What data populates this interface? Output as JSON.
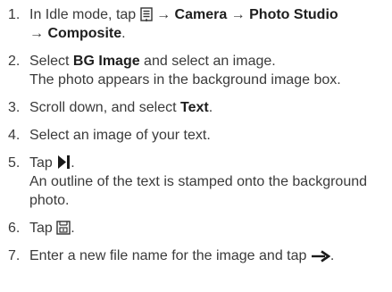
{
  "steps": [
    {
      "num": "1.",
      "t1": "In Idle mode, tap ",
      "icon": "menu-list-icon",
      "arrow1": " → ",
      "camera": "Camera",
      "arrow2": " → ",
      "studio": "Photo Studio",
      "arrow3": "→ ",
      "composite": "Composite",
      "end": "."
    },
    {
      "num": "2.",
      "t1": "Select ",
      "bg": "BG Image",
      "t2": " and select an image.",
      "result": "The photo appears in the background image box."
    },
    {
      "num": "3.",
      "t1": "Scroll down, and select ",
      "text": "Text",
      "end": "."
    },
    {
      "num": "4.",
      "t1": "Select an image of your text."
    },
    {
      "num": "5.",
      "t1": "Tap ",
      "icon": "stamp-icon",
      "end": ".",
      "result": "An outline of the text is stamped onto the background photo."
    },
    {
      "num": "6.",
      "t1": "Tap ",
      "icon": "save-icon",
      "end": "."
    },
    {
      "num": "7.",
      "t1": "Enter a new file name for the image and tap ",
      "icon": "arrow-right-icon",
      "end": "."
    }
  ]
}
